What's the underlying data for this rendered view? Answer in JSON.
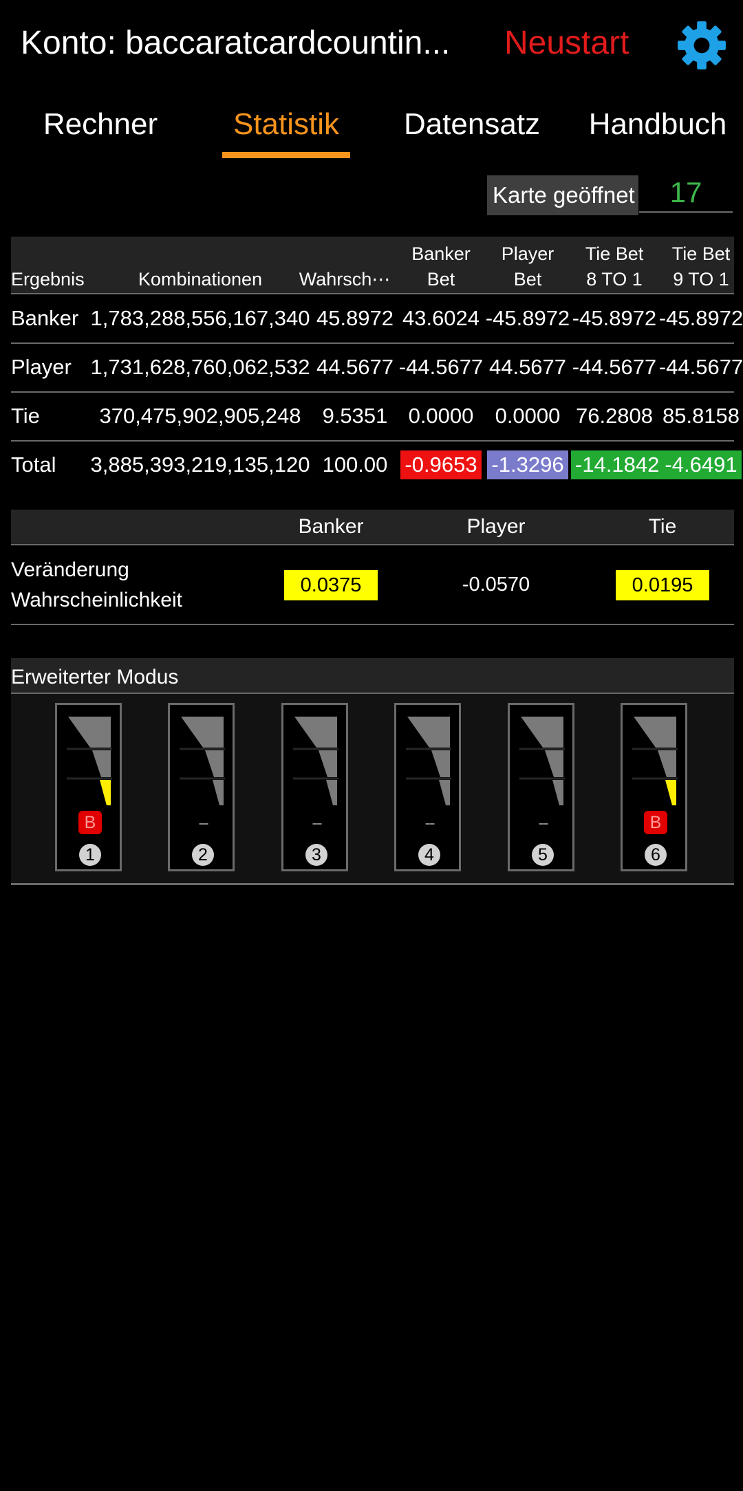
{
  "header": {
    "account_title": "Konto: baccaratcardcountin...",
    "restart_label": "Neustart",
    "accent_color": "#1ea1e6",
    "restart_color": "#e11b1b",
    "settings_icon": "gear-icon"
  },
  "tabs": [
    {
      "label": "Rechner",
      "active": false
    },
    {
      "label": "Statistik",
      "active": true
    },
    {
      "label": "Datensatz",
      "active": false
    },
    {
      "label": "Handbuch",
      "active": false
    }
  ],
  "card_opened": {
    "label": "Karte geöffnet",
    "value": "17"
  },
  "stats_table": {
    "headers": {
      "result": "Ergebnis",
      "combinations": "Kombinationen",
      "probability": "Wahrsch⋯",
      "banker_bet": [
        "Banker",
        "Bet"
      ],
      "player_bet": [
        "Player",
        "Bet"
      ],
      "tie_8": [
        "Tie Bet",
        "8 TO 1"
      ],
      "tie_9": [
        "Tie Bet",
        "9 TO 1"
      ]
    },
    "rows": [
      {
        "result": "Banker",
        "combinations": "1,783,288,556,167,340",
        "probability": "45.8972",
        "banker_bet": "43.6024",
        "player_bet": "-45.8972",
        "tie_8": "-45.8972",
        "tie_9": "-45.8972"
      },
      {
        "result": "Player",
        "combinations": "1,731,628,760,062,532",
        "probability": "44.5677",
        "banker_bet": "-44.5677",
        "player_bet": "44.5677",
        "tie_8": "-44.5677",
        "tie_9": "-44.5677"
      },
      {
        "result": "Tie",
        "combinations": "370,475,902,905,248",
        "probability": "9.5351",
        "banker_bet": "0.0000",
        "player_bet": "0.0000",
        "tie_8": "76.2808",
        "tie_9": "85.8158"
      },
      {
        "result": "Total",
        "combinations": "3,885,393,219,135,120",
        "probability": "100.00",
        "banker_bet": "-0.9653",
        "player_bet": "-1.3296",
        "tie_8": "-14.1842",
        "tie_9": "-4.6491"
      }
    ],
    "total_badge_colors": {
      "banker_bet": "#ee1111",
      "player_bet": "#7b7bcc",
      "tie_8": "#22aa33",
      "tie_9": "#22aa33"
    }
  },
  "probability_change": {
    "headers": {
      "banker": "Banker",
      "player": "Player",
      "tie": "Tie"
    },
    "label_line1": "Veränderung",
    "label_line2": "Wahrscheinlichkeit",
    "banker": "0.0375",
    "player": "-0.0570",
    "tie": "0.0195",
    "highlight_color": "#ffff00"
  },
  "extended_mode": {
    "title": "Erweiterter Modus",
    "decks": [
      {
        "number": "1",
        "mark": "B",
        "yellow_fill": 1
      },
      {
        "number": "2",
        "mark": "--",
        "yellow_fill": 0
      },
      {
        "number": "3",
        "mark": "--",
        "yellow_fill": 0
      },
      {
        "number": "4",
        "mark": "--",
        "yellow_fill": 0
      },
      {
        "number": "5",
        "mark": "--",
        "yellow_fill": 0
      },
      {
        "number": "6",
        "mark": "B",
        "yellow_fill": 1
      }
    ]
  }
}
